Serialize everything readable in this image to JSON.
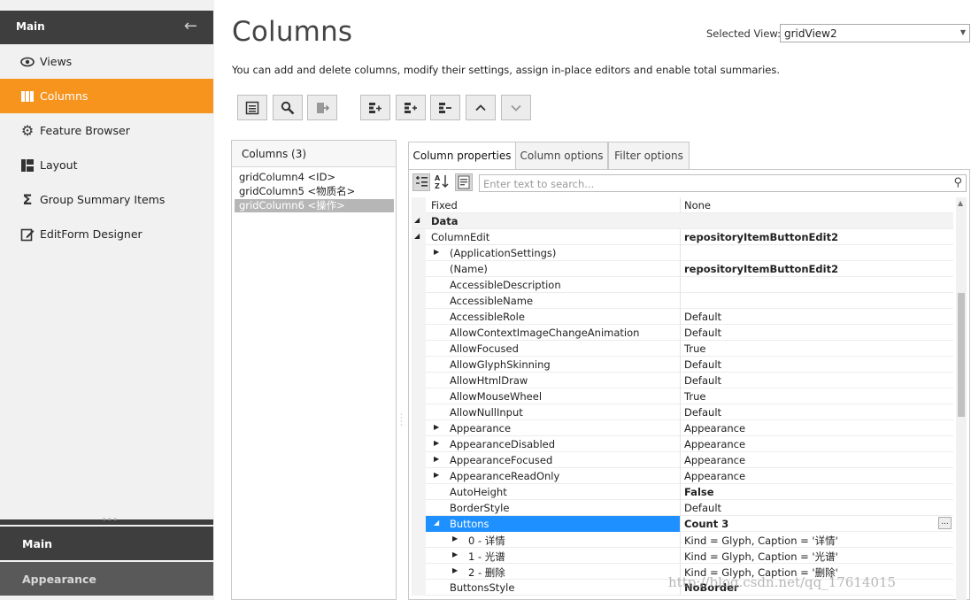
{
  "sidebar": {
    "header_title": "Main",
    "items": [
      {
        "label": "Views",
        "icon": "eye-icon"
      },
      {
        "label": "Columns",
        "icon": "columns-icon",
        "active": true
      },
      {
        "label": "Feature Browser",
        "icon": "gear-icon"
      },
      {
        "label": "Layout",
        "icon": "layout-icon"
      },
      {
        "label": "Group Summary Items",
        "icon": "sigma-icon"
      },
      {
        "label": "EditForm Designer",
        "icon": "edit-form-icon"
      }
    ],
    "groups": [
      {
        "label": "Main"
      },
      {
        "label": "Appearance"
      }
    ]
  },
  "header": {
    "title": "Columns",
    "selected_view_label": "Selected View:",
    "selected_view_value": "gridView2",
    "description": "You can add and delete columns, modify their settings, assign in-place editors and enable total summaries."
  },
  "toolbar": {
    "buttons": [
      "show-field-list",
      "retrieve-fields",
      "add-column",
      "insert-column",
      "remove-column",
      "move-up",
      "move-down"
    ]
  },
  "columns_panel": {
    "title": "Columns (3)",
    "items": [
      "gridColumn4 <ID>",
      "gridColumn5 <物质名>",
      "gridColumn6 <操作>"
    ],
    "selected_index": 2
  },
  "tabs": [
    "Column properties",
    "Column options",
    "Filter options"
  ],
  "search": {
    "placeholder": "Enter text to search..."
  },
  "properties": [
    {
      "name": "Fixed",
      "value": "None",
      "level": 0
    },
    {
      "name": "Data",
      "value": "",
      "category": true,
      "expanded": true
    },
    {
      "name": "ColumnEdit",
      "value": "repositoryItemButtonEdit2",
      "level": 0,
      "expanded": true,
      "bold": true
    },
    {
      "name": "(ApplicationSettings)",
      "value": "",
      "level": 1,
      "collapsed": true
    },
    {
      "name": "(Name)",
      "value": "repositoryItemButtonEdit2",
      "level": 1,
      "bold": true
    },
    {
      "name": "AccessibleDescription",
      "value": "",
      "level": 1
    },
    {
      "name": "AccessibleName",
      "value": "",
      "level": 1
    },
    {
      "name": "AccessibleRole",
      "value": "Default",
      "level": 1
    },
    {
      "name": "AllowContextImageChangeAnimation",
      "value": "Default",
      "level": 1
    },
    {
      "name": "AllowFocused",
      "value": "True",
      "level": 1
    },
    {
      "name": "AllowGlyphSkinning",
      "value": "Default",
      "level": 1
    },
    {
      "name": "AllowHtmlDraw",
      "value": "Default",
      "level": 1
    },
    {
      "name": "AllowMouseWheel",
      "value": "True",
      "level": 1
    },
    {
      "name": "AllowNullInput",
      "value": "Default",
      "level": 1
    },
    {
      "name": "Appearance",
      "value": "Appearance",
      "level": 1,
      "collapsed": true
    },
    {
      "name": "AppearanceDisabled",
      "value": "Appearance",
      "level": 1,
      "collapsed": true
    },
    {
      "name": "AppearanceFocused",
      "value": "Appearance",
      "level": 1,
      "collapsed": true
    },
    {
      "name": "AppearanceReadOnly",
      "value": "Appearance",
      "level": 1,
      "collapsed": true
    },
    {
      "name": "AutoHeight",
      "value": "False",
      "level": 1,
      "bold": true
    },
    {
      "name": "BorderStyle",
      "value": "Default",
      "level": 1
    },
    {
      "name": "Buttons",
      "value": "Count 3",
      "level": 1,
      "expanded": true,
      "bold": true,
      "selected": true,
      "ellipsis": "..."
    },
    {
      "name": "0 - 详情",
      "value": "Kind = Glyph, Caption = '详情'",
      "level": 2,
      "collapsed": true
    },
    {
      "name": "1 - 光谱",
      "value": "Kind = Glyph, Caption = '光谱'",
      "level": 2,
      "collapsed": true
    },
    {
      "name": "2 - 删除",
      "value": "Kind = Glyph, Caption = '删除'",
      "level": 2,
      "collapsed": true
    },
    {
      "name": "ButtonsStyle",
      "value": "NoBorder",
      "level": 1,
      "bold": true
    }
  ],
  "watermark": "http://blog.csdn.net/qq_17614015",
  "colors": {
    "accent": "#f7941d",
    "sidebar_dark": "#3e3e3e",
    "selection": "#1e90ff"
  }
}
